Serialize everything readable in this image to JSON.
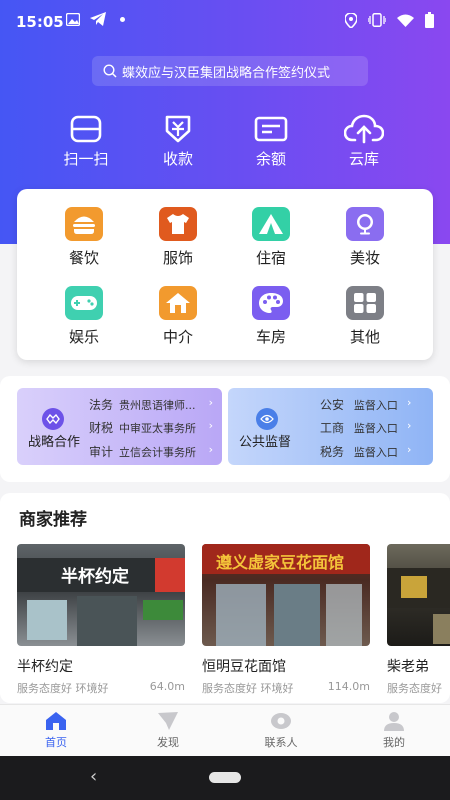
{
  "status_bar": {
    "time": "15:05",
    "icons": [
      "image-icon",
      "telegram-icon",
      "dot-icon",
      "location-icon",
      "vibrate-icon",
      "wifi-icon",
      "battery-icon"
    ]
  },
  "search": {
    "placeholder": "蝶效应与汉臣集团战略合作签约仪式"
  },
  "quick_actions": [
    {
      "label": "扫一扫",
      "icon": "scan-icon"
    },
    {
      "label": "收款",
      "icon": "receive-payment-icon"
    },
    {
      "label": "余额",
      "icon": "wallet-icon"
    },
    {
      "label": "云库",
      "icon": "cloud-upload-icon"
    }
  ],
  "categories": [
    {
      "label": "餐饮",
      "icon": "burger-icon",
      "color": "#f29a2e"
    },
    {
      "label": "服饰",
      "icon": "tshirt-icon",
      "color": "#e05a1e"
    },
    {
      "label": "住宿",
      "icon": "tent-icon",
      "color": "#33d0a6"
    },
    {
      "label": "美妆",
      "icon": "mirror-icon",
      "color": "#8a6df0"
    },
    {
      "label": "娱乐",
      "icon": "gamepad-icon",
      "color": "#3fd0b0"
    },
    {
      "label": "中介",
      "icon": "house-icon",
      "color": "#f29a2e"
    },
    {
      "label": "车房",
      "icon": "palette-icon",
      "color": "#7b5ef0"
    },
    {
      "label": "其他",
      "icon": "grid-icon",
      "color": "#7d7f86"
    }
  ],
  "cooperation": {
    "strategic": {
      "title": "战略合作",
      "rows": [
        {
          "key": "法务",
          "value": "贵州思语律师..."
        },
        {
          "key": "财税",
          "value": "中审亚太事务所"
        },
        {
          "key": "审计",
          "value": "立信会计事务所"
        }
      ]
    },
    "public": {
      "title": "公共监督",
      "rows": [
        {
          "key": "公安",
          "value": "监督入口"
        },
        {
          "key": "工商",
          "value": "监督入口"
        },
        {
          "key": "税务",
          "value": "监督入口"
        }
      ]
    },
    "arrow": "›"
  },
  "merchants": {
    "title": "商家推荐",
    "items": [
      {
        "name": "半杯约定",
        "meta": "服务态度好 环境好",
        "distance": "64.0m",
        "sign_text": "半杯约定"
      },
      {
        "name": "恒明豆花面馆",
        "meta": "服务态度好 环境好",
        "distance": "114.0m",
        "sign_text": "遵义虚家豆花面馆"
      },
      {
        "name": "柴老弟",
        "meta": "服务态度好",
        "distance": "",
        "sign_text": ""
      }
    ]
  },
  "tabs": [
    {
      "label": "首页",
      "icon": "home-icon",
      "active": true
    },
    {
      "label": "发现",
      "icon": "discover-icon",
      "active": false
    },
    {
      "label": "联系人",
      "icon": "contacts-icon",
      "active": false
    },
    {
      "label": "我的",
      "icon": "profile-icon",
      "active": false
    }
  ],
  "colors": {
    "accent": "#3a63f0",
    "hero_start": "#4556f4",
    "hero_end": "#8a48f0"
  }
}
